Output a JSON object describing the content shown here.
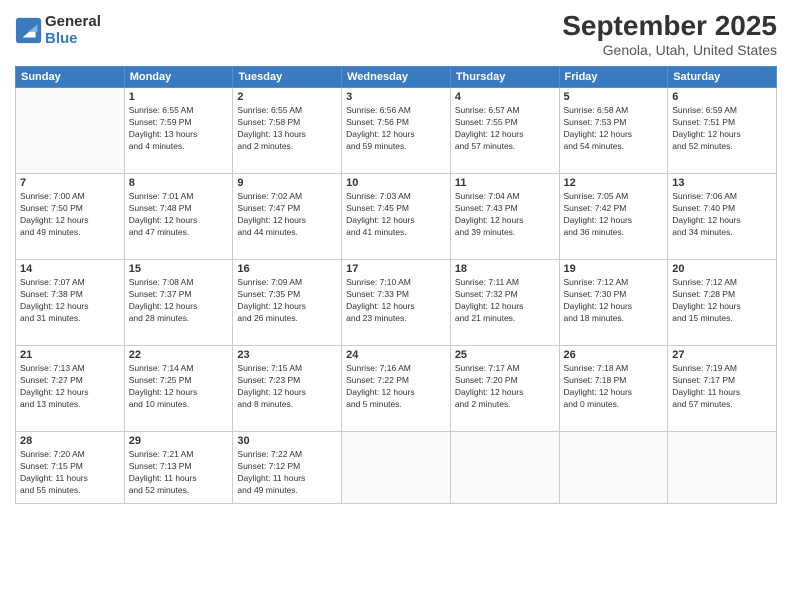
{
  "logo": {
    "general": "General",
    "blue": "Blue"
  },
  "title": "September 2025",
  "location": "Genola, Utah, United States",
  "weekdays": [
    "Sunday",
    "Monday",
    "Tuesday",
    "Wednesday",
    "Thursday",
    "Friday",
    "Saturday"
  ],
  "weeks": [
    [
      {
        "day": "",
        "info": ""
      },
      {
        "day": "1",
        "info": "Sunrise: 6:55 AM\nSunset: 7:59 PM\nDaylight: 13 hours\nand 4 minutes."
      },
      {
        "day": "2",
        "info": "Sunrise: 6:55 AM\nSunset: 7:58 PM\nDaylight: 13 hours\nand 2 minutes."
      },
      {
        "day": "3",
        "info": "Sunrise: 6:56 AM\nSunset: 7:56 PM\nDaylight: 12 hours\nand 59 minutes."
      },
      {
        "day": "4",
        "info": "Sunrise: 6:57 AM\nSunset: 7:55 PM\nDaylight: 12 hours\nand 57 minutes."
      },
      {
        "day": "5",
        "info": "Sunrise: 6:58 AM\nSunset: 7:53 PM\nDaylight: 12 hours\nand 54 minutes."
      },
      {
        "day": "6",
        "info": "Sunrise: 6:59 AM\nSunset: 7:51 PM\nDaylight: 12 hours\nand 52 minutes."
      }
    ],
    [
      {
        "day": "7",
        "info": "Sunrise: 7:00 AM\nSunset: 7:50 PM\nDaylight: 12 hours\nand 49 minutes."
      },
      {
        "day": "8",
        "info": "Sunrise: 7:01 AM\nSunset: 7:48 PM\nDaylight: 12 hours\nand 47 minutes."
      },
      {
        "day": "9",
        "info": "Sunrise: 7:02 AM\nSunset: 7:47 PM\nDaylight: 12 hours\nand 44 minutes."
      },
      {
        "day": "10",
        "info": "Sunrise: 7:03 AM\nSunset: 7:45 PM\nDaylight: 12 hours\nand 41 minutes."
      },
      {
        "day": "11",
        "info": "Sunrise: 7:04 AM\nSunset: 7:43 PM\nDaylight: 12 hours\nand 39 minutes."
      },
      {
        "day": "12",
        "info": "Sunrise: 7:05 AM\nSunset: 7:42 PM\nDaylight: 12 hours\nand 36 minutes."
      },
      {
        "day": "13",
        "info": "Sunrise: 7:06 AM\nSunset: 7:40 PM\nDaylight: 12 hours\nand 34 minutes."
      }
    ],
    [
      {
        "day": "14",
        "info": "Sunrise: 7:07 AM\nSunset: 7:38 PM\nDaylight: 12 hours\nand 31 minutes."
      },
      {
        "day": "15",
        "info": "Sunrise: 7:08 AM\nSunset: 7:37 PM\nDaylight: 12 hours\nand 28 minutes."
      },
      {
        "day": "16",
        "info": "Sunrise: 7:09 AM\nSunset: 7:35 PM\nDaylight: 12 hours\nand 26 minutes."
      },
      {
        "day": "17",
        "info": "Sunrise: 7:10 AM\nSunset: 7:33 PM\nDaylight: 12 hours\nand 23 minutes."
      },
      {
        "day": "18",
        "info": "Sunrise: 7:11 AM\nSunset: 7:32 PM\nDaylight: 12 hours\nand 21 minutes."
      },
      {
        "day": "19",
        "info": "Sunrise: 7:12 AM\nSunset: 7:30 PM\nDaylight: 12 hours\nand 18 minutes."
      },
      {
        "day": "20",
        "info": "Sunrise: 7:12 AM\nSunset: 7:28 PM\nDaylight: 12 hours\nand 15 minutes."
      }
    ],
    [
      {
        "day": "21",
        "info": "Sunrise: 7:13 AM\nSunset: 7:27 PM\nDaylight: 12 hours\nand 13 minutes."
      },
      {
        "day": "22",
        "info": "Sunrise: 7:14 AM\nSunset: 7:25 PM\nDaylight: 12 hours\nand 10 minutes."
      },
      {
        "day": "23",
        "info": "Sunrise: 7:15 AM\nSunset: 7:23 PM\nDaylight: 12 hours\nand 8 minutes."
      },
      {
        "day": "24",
        "info": "Sunrise: 7:16 AM\nSunset: 7:22 PM\nDaylight: 12 hours\nand 5 minutes."
      },
      {
        "day": "25",
        "info": "Sunrise: 7:17 AM\nSunset: 7:20 PM\nDaylight: 12 hours\nand 2 minutes."
      },
      {
        "day": "26",
        "info": "Sunrise: 7:18 AM\nSunset: 7:18 PM\nDaylight: 12 hours\nand 0 minutes."
      },
      {
        "day": "27",
        "info": "Sunrise: 7:19 AM\nSunset: 7:17 PM\nDaylight: 11 hours\nand 57 minutes."
      }
    ],
    [
      {
        "day": "28",
        "info": "Sunrise: 7:20 AM\nSunset: 7:15 PM\nDaylight: 11 hours\nand 55 minutes."
      },
      {
        "day": "29",
        "info": "Sunrise: 7:21 AM\nSunset: 7:13 PM\nDaylight: 11 hours\nand 52 minutes."
      },
      {
        "day": "30",
        "info": "Sunrise: 7:22 AM\nSunset: 7:12 PM\nDaylight: 11 hours\nand 49 minutes."
      },
      {
        "day": "",
        "info": ""
      },
      {
        "day": "",
        "info": ""
      },
      {
        "day": "",
        "info": ""
      },
      {
        "day": "",
        "info": ""
      }
    ]
  ]
}
